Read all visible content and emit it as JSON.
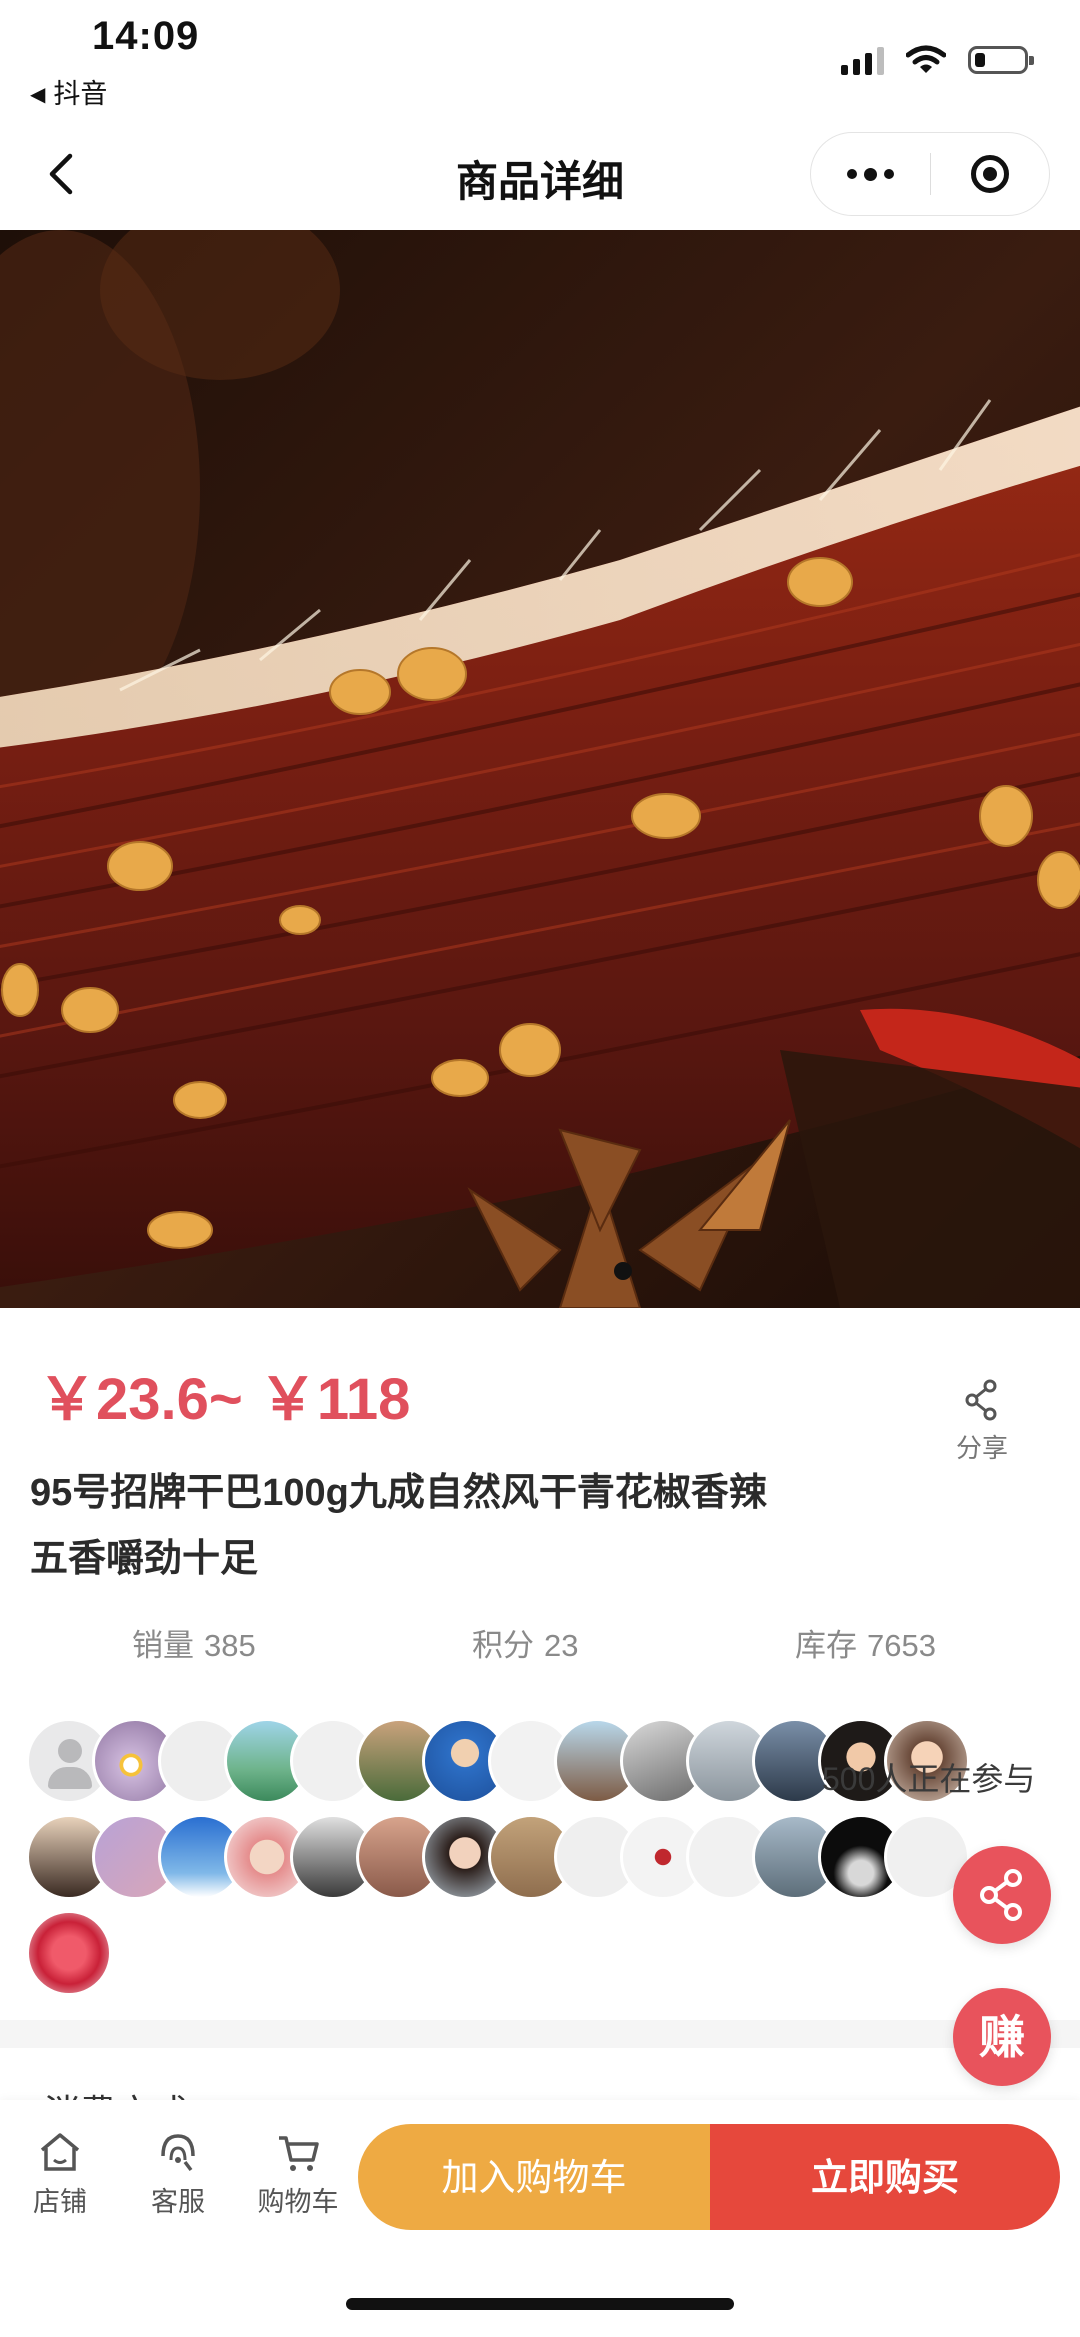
{
  "status_bar": {
    "time": "14:09",
    "back_app": "抖音"
  },
  "nav": {
    "title": "商品详细"
  },
  "product": {
    "price": "￥23.6~ ￥118",
    "title_line1": "95号招牌干巴100g九成自然风干青花椒香辣",
    "title_line2": "五香嚼劲十足",
    "share_label": "分享"
  },
  "stats": {
    "sales_label": "销量",
    "sales_value": "385",
    "points_label": "积分",
    "points_value": "23",
    "stock_label": "库存",
    "stock_value": "7653"
  },
  "participants": {
    "text": "500人正在参与"
  },
  "floating": {
    "earn_label": "赚"
  },
  "section_peek": "消费方式",
  "bottom_bar": {
    "store_label": "店铺",
    "service_label": "客服",
    "cart_label": "购物车",
    "add_to_cart": "加入购物车",
    "buy_now": "立即购买"
  },
  "colors": {
    "price_red": "#e0505d",
    "cart_orange": "#eeaa43",
    "buy_red": "#e6483c",
    "float_red": "#e8535c"
  },
  "icons": {
    "back": "chevron-left-icon",
    "more": "more-dots-icon",
    "close": "target-close-icon",
    "share": "share-icon",
    "store": "store-icon",
    "service": "headset-icon",
    "cart": "cart-icon"
  }
}
